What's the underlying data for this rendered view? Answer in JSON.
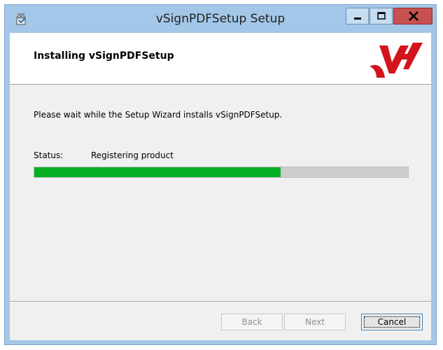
{
  "window": {
    "title": "vSignPDFSetup Setup",
    "icon": "installer-package-icon"
  },
  "banner": {
    "title": "Installing vSignPDFSetup",
    "logo": "vsign-logo-icon",
    "logo_color": "#d4141c"
  },
  "body": {
    "description": "Please wait while the Setup Wizard installs vSignPDFSetup.",
    "status_label": "Status:",
    "status_value": "Registering product",
    "progress_percent": 66,
    "progress_color": "#06b025"
  },
  "buttons": {
    "back": "Back",
    "next": "Next",
    "cancel": "Cancel"
  }
}
